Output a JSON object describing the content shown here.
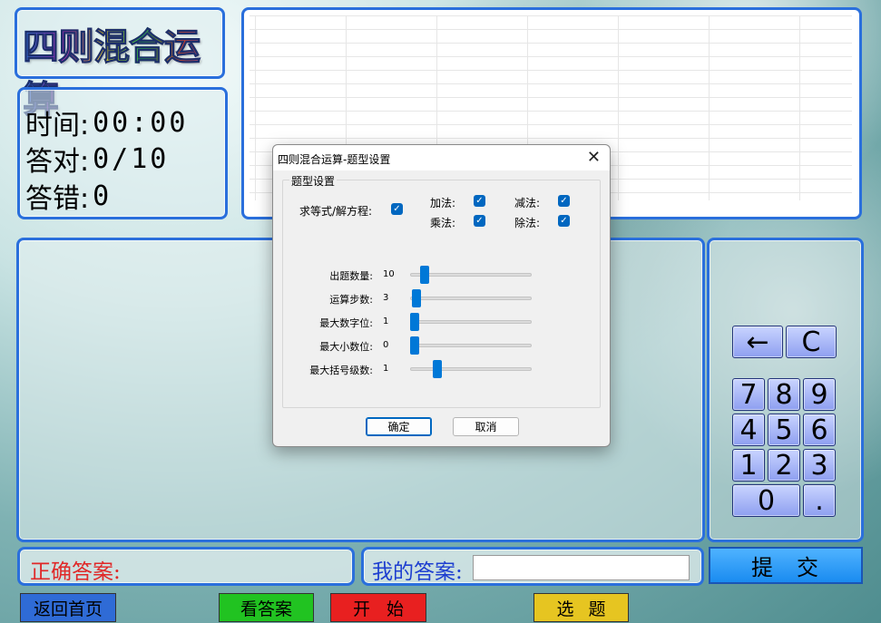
{
  "app": {
    "title": "四则混合运算"
  },
  "stats": {
    "time_label": "时间:",
    "time_value": "00:00",
    "correct_label": "答对:",
    "correct_value": "0/10",
    "wrong_label": "答错:",
    "wrong_value": "0"
  },
  "keypad": {
    "keys": [
      "←",
      "C",
      "7",
      "8",
      "9",
      "4",
      "5",
      "6",
      "1",
      "2",
      "3",
      "0",
      "."
    ]
  },
  "answer_area": {
    "correct_label": "正确答案:",
    "mine_label": "我的答案:",
    "mine_value": ""
  },
  "buttons": {
    "submit": "提交",
    "home": "返回首页",
    "show_answer": "看答案",
    "start": "开始",
    "pick": "选题"
  },
  "dialog": {
    "title": "四则混合运算-题型设置",
    "group_label": "题型设置",
    "equation_label": "求等式/解方程:",
    "equation_checked": true,
    "ops": [
      {
        "label": "加法:",
        "checked": true
      },
      {
        "label": "减法:",
        "checked": true
      },
      {
        "label": "乘法:",
        "checked": true
      },
      {
        "label": "除法:",
        "checked": true
      }
    ],
    "sliders": [
      {
        "label": "出题数量:",
        "value": "10"
      },
      {
        "label": "运算步数:",
        "value": "3"
      },
      {
        "label": "最大数字位:",
        "value": "1"
      },
      {
        "label": "最大小数位:",
        "value": "0"
      },
      {
        "label": "最大括号级数:",
        "value": "1"
      }
    ],
    "ok_label": "确定",
    "cancel_label": "取消"
  },
  "colors": {
    "panel_border": "#2a6fdc",
    "correct_text": "#e02828",
    "mine_text": "#1e3fd0",
    "submit_bg": "#1a8bf0",
    "home_bg": "#2f6bd6",
    "answer_bg": "#21c321",
    "start_bg": "#e82020",
    "pick_bg": "#e6c521",
    "checkbox": "#0067c0"
  }
}
